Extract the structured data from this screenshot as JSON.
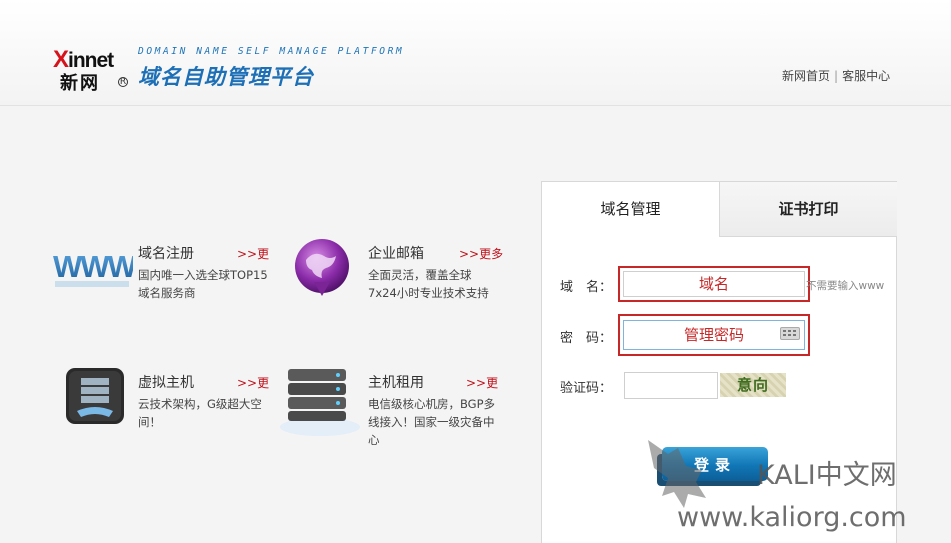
{
  "header": {
    "logo_x": "X",
    "logo_rest": "innet",
    "logo_cn": "新网",
    "logo_reg": "R",
    "platform_en": "DOMAIN NAME SELF MANAGE PLATFORM",
    "platform_cn": "域名自助管理平台",
    "links": [
      "新网首页",
      "客服中心"
    ],
    "separator": "|"
  },
  "services": [
    {
      "title": "域名注册",
      "more": ">>更",
      "desc": "国内唯一入选全球TOP15域名服务商",
      "icon": "www-icon"
    },
    {
      "title": "企业邮箱",
      "more": ">>更多",
      "desc": "全面灵活，覆盖全球7x24小时专业技术支持",
      "icon": "enterprise-mail-icon"
    },
    {
      "title": "虚拟主机",
      "more": ">>更",
      "desc": "云技术架构，G级超大空间！",
      "icon": "virtual-host-icon"
    },
    {
      "title": "主机租用",
      "more": ">>更",
      "desc": "电信级核心机房，BGP多线接入！国家一级灾备中心",
      "icon": "server-rental-icon"
    }
  ],
  "login": {
    "tabs": [
      "域名管理",
      "证书打印"
    ],
    "domain_label": "域　名：",
    "domain_placeholder": "域名",
    "domain_hint": "不需要输入www",
    "password_label": "密　码：",
    "password_placeholder": "管理密码",
    "captcha_label": "验证码：",
    "captcha_value": "",
    "captcha_text": "意向",
    "submit_label": "登录"
  },
  "watermark": {
    "line1": "KALI中文网",
    "line2": "www.kaliorg.com"
  },
  "colors": {
    "brand_blue": "#1d6fb6",
    "brand_red": "#d6121a",
    "highlight_red": "#c62828"
  }
}
